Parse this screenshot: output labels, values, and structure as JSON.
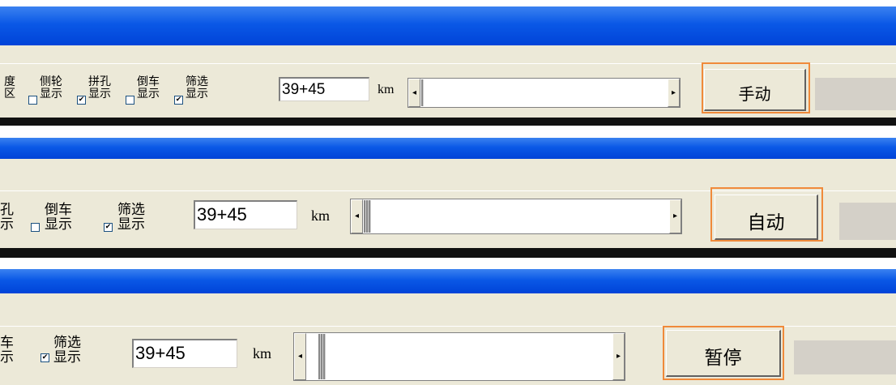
{
  "panels": [
    {
      "labels": [
        [
          "度",
          "区"
        ],
        [
          "侧轮",
          "显示"
        ],
        [
          "拼孔",
          "显示"
        ],
        [
          "倒车",
          "显示"
        ],
        [
          "筛选",
          "显示"
        ]
      ],
      "checkboxes": [
        "",
        "✔",
        "",
        "✔"
      ],
      "mileage_value": "39+45",
      "unit": "km",
      "scroll_left": "◂",
      "scroll_right": "▸",
      "mode_button": "手动"
    },
    {
      "labels": [
        [
          "孔",
          "示"
        ],
        [
          "倒车",
          "显示"
        ],
        [
          "筛选",
          "显示"
        ]
      ],
      "checkboxes": [
        "",
        "✔"
      ],
      "mileage_value": "39+45",
      "unit": "km",
      "scroll_left": "◂",
      "scroll_right": "▸",
      "mode_button": "自动"
    },
    {
      "labels": [
        [
          "车",
          "示"
        ],
        [
          "筛选",
          "显示"
        ]
      ],
      "checkboxes": [
        "✔"
      ],
      "mileage_value": "39+45",
      "unit": "km",
      "scroll_left": "◂",
      "scroll_right": "▸",
      "mode_button": "暂停"
    }
  ]
}
